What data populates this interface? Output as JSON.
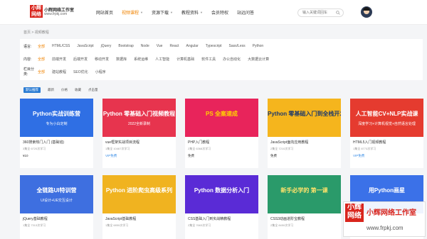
{
  "header": {
    "logo_text": "小辉网络",
    "site_name": "小辉网络工作室",
    "site_url": "www.frpkj.com",
    "nav": [
      {
        "label": "网站首页",
        "caret": false,
        "active": false
      },
      {
        "label": "视频课程",
        "caret": true,
        "active": true
      },
      {
        "label": "资源下载",
        "caret": true,
        "active": false
      },
      {
        "label": "教程资料",
        "caret": true,
        "active": false
      },
      {
        "label": "会员特权",
        "caret": false,
        "active": false
      },
      {
        "label": "站远问答",
        "caret": false,
        "active": false
      }
    ],
    "search_placeholder": "输入关键词回车"
  },
  "breadcrumb": "首页 > 视频教程",
  "filters": [
    {
      "label": "语言:",
      "options": [
        "全部",
        "HTML/CSS",
        "JavaScript",
        "jQuery",
        "Bootstrap",
        "Node",
        "Vue",
        "React",
        "Angular",
        "Typescript",
        "Sass/Less",
        "Python"
      ]
    },
    {
      "label": "内容:",
      "options": [
        "全部",
        "前端开发",
        "后端开发",
        "移动开发",
        "数据库",
        "系统运维",
        "人工智能",
        "计算机基础",
        "软件工具",
        "办公自动化",
        "大数据云计算"
      ]
    },
    {
      "label": "栏目分类:",
      "options": [
        "全部",
        "建站教程",
        "SEO优化",
        "小程序"
      ]
    }
  ],
  "sort": [
    "默认推荐",
    "最新",
    "价格",
    "收藏",
    "点击量"
  ],
  "courses": [
    {
      "thumb_title": "Python实战训练营",
      "thumb_sub": "专为小白定制",
      "bg": "#2f6fe4",
      "fg": "#ffffff",
      "title": "360搜索热门入门 (基础班)",
      "meta": "3集全 6720次学习",
      "price": "¥10",
      "vip": false
    },
    {
      "thumb_title": "Python 零基础入门视频教程",
      "thumb_sub": "2022全新录制",
      "bg": "#e7344e",
      "fg": "#ffffff",
      "title": "vue框架实战项目流程",
      "meta": "1集全 10467次学习",
      "price": "VIP免费",
      "vip": true
    },
    {
      "thumb_title": "PS 全案速成",
      "thumb_sub": "",
      "bg": "#e8245b",
      "fg": "#ffd400",
      "title": "PHP入门教程",
      "meta": "2集全 6368次学习",
      "price": "免费",
      "vip": false
    },
    {
      "thumb_title": "Python 零基础入门到全栈开发",
      "thumb_sub": "",
      "bg": "#f5b51d",
      "fg": "#1f3a6b",
      "title": "JavaScript面向应用教程",
      "meta": "2集全 7210次学习",
      "price": "免费",
      "vip": false
    },
    {
      "thumb_title": "人工智能CV+NLP实战课",
      "thumb_sub": "深度学习+计算机视觉+自然语言处理",
      "bg": "#e53b2f",
      "fg": "#ffffff",
      "title": "HTML5入门视频教程",
      "meta": "1集全 8773次学习",
      "price": "VIP免费",
      "vip": true
    },
    {
      "thumb_title": "全链路UI特训营",
      "thumb_sub": "UI设计+UE交互设计",
      "bg": "#3e6fe0",
      "fg": "#ffffff",
      "title": "jQuery基础教程",
      "meta": "1集全 7313次学习",
      "price": "",
      "vip": false
    },
    {
      "thumb_title": "Python 进阶爬虫高级系列",
      "thumb_sub": "",
      "bg": "#f0b320",
      "fg": "#ffffff",
      "title": "JavaScript基础教程",
      "meta": "1集全 6850次学习",
      "price": "",
      "vip": false
    },
    {
      "thumb_title": "Python 数据分析入门",
      "thumb_sub": "",
      "bg": "#5a2bd6",
      "fg": "#ffffff",
      "title": "CSS基础入门到实战精教程",
      "meta": "2集全 7663次学习",
      "price": "",
      "vip": false
    },
    {
      "thumb_title": "新手必学的 第一课",
      "thumb_sub": "",
      "bg": "#2a9a6a",
      "fg": "#ffe36a",
      "title": "CSS3动画进阶宝教程",
      "meta": "2集全 8450次学习",
      "price": "",
      "vip": false
    },
    {
      "thumb_title": "用Python画星",
      "thumb_sub": "",
      "bg": "#3b71e8",
      "fg": "#ffffff",
      "title": "",
      "meta": "",
      "price": "",
      "vip": false
    }
  ],
  "watermark": {
    "logo_text": "小辉网络",
    "name": "小辉网络工作室",
    "url": "www.frpkj.com"
  }
}
